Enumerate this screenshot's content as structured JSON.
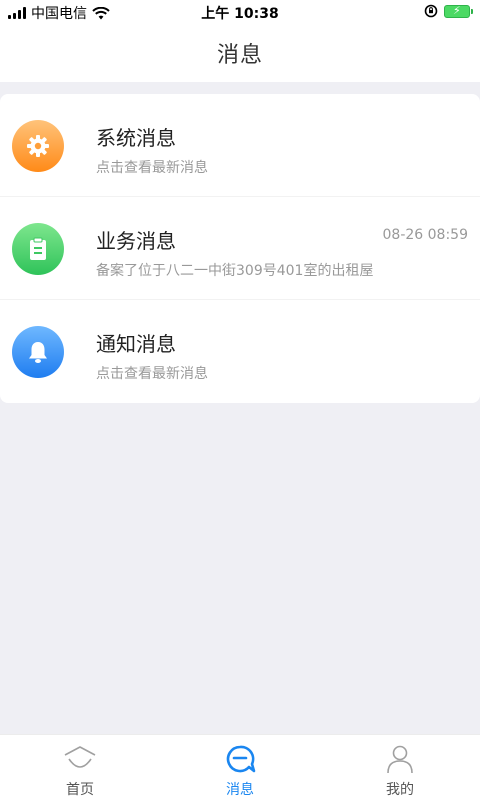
{
  "status_bar": {
    "carrier": "中国电信",
    "time": "上午 10:38"
  },
  "header": {
    "title": "消息"
  },
  "messages": [
    {
      "title": "系统消息",
      "subtitle": "点击查看最新消息",
      "time": "",
      "icon": "gear-icon",
      "color_top": "#ffc37a",
      "color_bottom": "#ff8a18"
    },
    {
      "title": "业务消息",
      "subtitle": "备案了位于八二一中街309号401室的出租屋",
      "time": "08-26 08:59",
      "icon": "clipboard-icon",
      "color_top": "#7ee68e",
      "color_bottom": "#2fc35a"
    },
    {
      "title": "通知消息",
      "subtitle": "点击查看最新消息",
      "time": "",
      "icon": "bell-icon",
      "color_top": "#6fb8ff",
      "color_bottom": "#1f7df0"
    }
  ],
  "tabs": [
    {
      "label": "首页",
      "icon": "home-icon",
      "active": false
    },
    {
      "label": "消息",
      "icon": "message-icon",
      "active": true
    },
    {
      "label": "我的",
      "icon": "user-icon",
      "active": false
    }
  ],
  "colors": {
    "accent": "#1a86f0",
    "inactive": "#555555",
    "background": "#efeff4"
  }
}
